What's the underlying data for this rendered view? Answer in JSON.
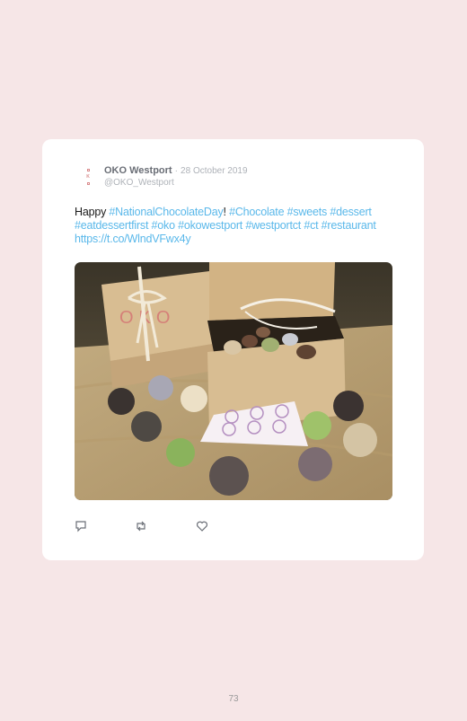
{
  "tweet": {
    "author_name": "OKO Westport",
    "separator": "·",
    "date": "28 October 2019",
    "handle": "@OKO_Westport",
    "text_lead": "Happy ",
    "link1": "#NationalChocolateDay",
    "excl": "! ",
    "link2": "#Chocolate #sweets #dessert #eatdessertfirst #oko #okowestport #westportct #ct #restaurant https://t.co/WlndVFwx4y",
    "photo_logo_text": "OKO"
  },
  "actions": [
    {
      "icon": "reply-icon"
    },
    {
      "icon": "retweet-icon"
    },
    {
      "icon": "heart-icon"
    }
  ],
  "page_number": "73"
}
